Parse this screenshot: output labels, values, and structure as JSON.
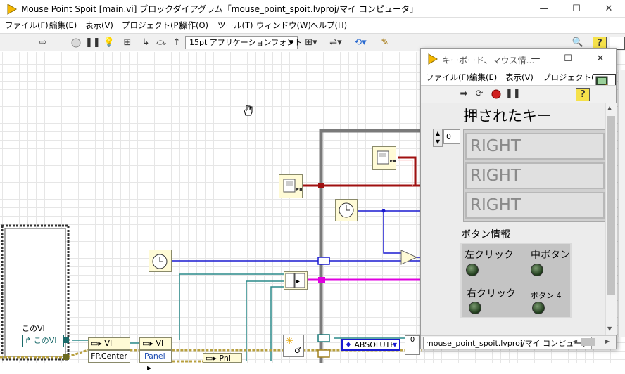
{
  "main_window": {
    "title": "Mouse Point Spoit [main.vi] ブロックダイアグラム「mouse_point_spoit.lvproj/マイ コンピュータ」",
    "minimize": "—",
    "maximize": "☐",
    "close": "✕"
  },
  "menubar": {
    "items": [
      "ファイル(F)",
      "編集(E)",
      "表示(V)",
      "プロジェクト(P)",
      "操作(O)",
      "ツール(T)",
      "ウィンドウ(W)",
      "ヘルプ(H)"
    ]
  },
  "toolbar": {
    "font_select": "15pt アプリケーションフォント",
    "help": "?"
  },
  "diagram": {
    "label_this_vi_caption": "このVI",
    "label_this_vi": "このVI",
    "node_vi": "VI",
    "node_vi2": "VI",
    "label_fp_center": "FP.Center",
    "label_panel": "Panel",
    "label_pnl": "Pnl",
    "label_absolute": "ABSOLUTE",
    "label_zero": "0"
  },
  "front_panel": {
    "title": "キーボード、マウス情…",
    "minimize": "—",
    "maximize": "☐",
    "close": "✕",
    "menu": [
      "ファイル(F)",
      "編集(E)",
      "表示(V)",
      "プロジェクト(P)"
    ],
    "help": "?",
    "keys_label": "押されたキー",
    "index_value": "0",
    "key_values": [
      "RIGHT",
      "RIGHT",
      "RIGHT"
    ],
    "button_info_label": "ボタン情報",
    "btn_left": "左クリック",
    "btn_middle": "中ボタン",
    "btn_right": "右クリック",
    "btn_4": "ボタン 4",
    "status_path": "mouse_point_spoit.lvproj/マイ コンピュータ",
    "icon_number": "1"
  }
}
